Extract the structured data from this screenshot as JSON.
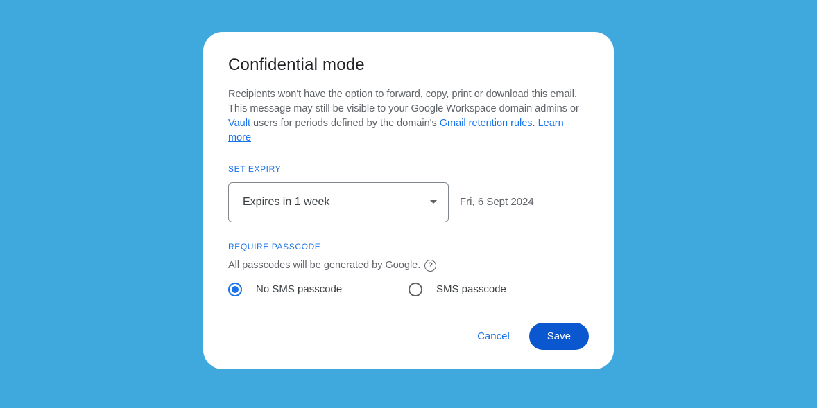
{
  "dialog": {
    "title": "Confidential mode",
    "desc_part1": "Recipients won't have the option to forward, copy, print or download this email. This message may still be visible to your Google Workspace domain admins or ",
    "link_vault": "Vault",
    "desc_part2": " users for periods defined by the domain's ",
    "link_retention": "Gmail retention rules",
    "desc_part3": ". ",
    "link_learn": "Learn more",
    "expiry": {
      "label": "SET EXPIRY",
      "selected": "Expires in 1 week",
      "date": "Fri, 6 Sept 2024"
    },
    "passcode": {
      "label": "REQUIRE PASSCODE",
      "note": "All passcodes will be generated by Google.",
      "options": [
        {
          "label": "No SMS passcode",
          "checked": true
        },
        {
          "label": "SMS passcode",
          "checked": false
        }
      ]
    },
    "actions": {
      "cancel": "Cancel",
      "save": "Save"
    }
  }
}
